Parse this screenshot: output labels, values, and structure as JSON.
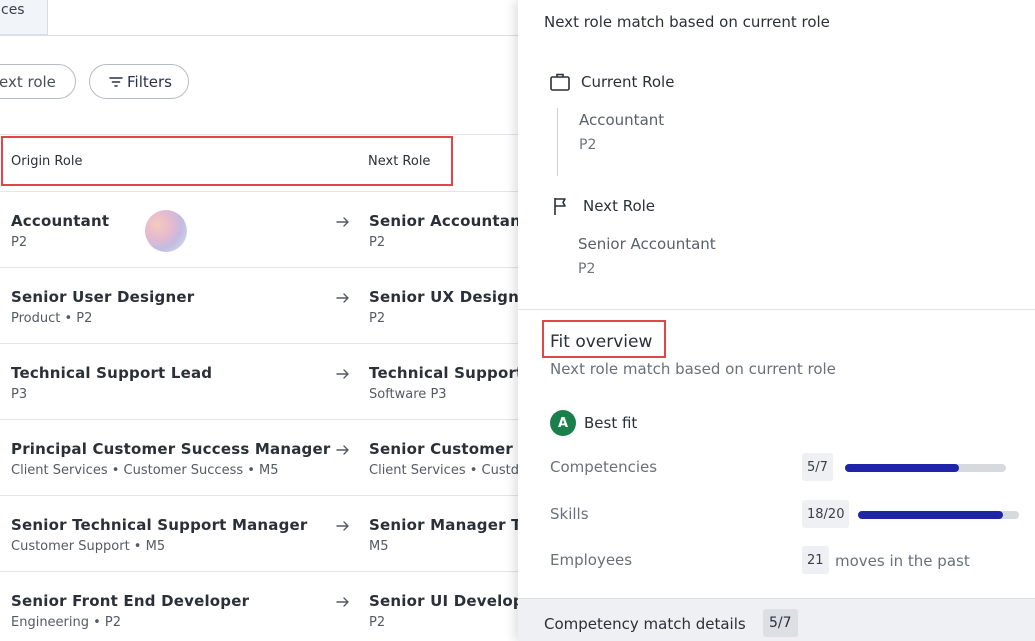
{
  "left": {
    "tab_fragment": "ces",
    "toolbar": {
      "next_role_pill": "ext role",
      "filters_label": "Filters"
    },
    "table": {
      "headers": {
        "origin": "Origin Role",
        "next": "Next Role"
      },
      "rows": [
        {
          "origin_title": "Accountant",
          "origin_sub": "P2",
          "next_title": "Senior Accountant",
          "next_sub": "P2"
        },
        {
          "origin_title": "Senior User Designer",
          "origin_sub": "Product • P2",
          "next_title": "Senior UX Designer",
          "next_sub": "P2"
        },
        {
          "origin_title": "Technical Support Lead",
          "origin_sub": "P3",
          "next_title": "Technical Support",
          "next_sub": "Software P3"
        },
        {
          "origin_title": "Principal Customer Success Manager",
          "origin_sub": "Client Services • Customer Success • M5",
          "next_title": "Senior Customer S",
          "next_sub": "Client Services • Custd"
        },
        {
          "origin_title": "Senior Technical Support Manager",
          "origin_sub": "Customer Support • M5",
          "next_title": "Senior Manager Te",
          "next_sub": "M5"
        },
        {
          "origin_title": "Senior Front End Developer",
          "origin_sub": "Engineering • P2",
          "next_title": "Senior UI Develope",
          "next_sub": "P2"
        }
      ]
    }
  },
  "right": {
    "title": "Next role match based on current role",
    "current_role": {
      "heading": "Current Role",
      "name": "Accountant",
      "grade": "P2"
    },
    "next_role": {
      "heading": "Next Role",
      "name": "Senior Accountant",
      "grade": "P2"
    },
    "fit": {
      "title": "Fit overview",
      "subtitle": "Next role match based on current role",
      "badge_letter": "A",
      "badge_label": "Best fit",
      "competencies": {
        "label": "Competencies",
        "value": "5/7",
        "progress": 0.71
      },
      "skills": {
        "label": "Skills",
        "value": "18/20",
        "progress": 0.9
      },
      "employees": {
        "label": "Employees",
        "value": "21",
        "suffix": "moves in the past"
      }
    },
    "footer": {
      "label": "Competency match details",
      "value": "5/7"
    }
  },
  "colors": {
    "highlight_red": "#e0474c",
    "progress_fill": "#1f24a8",
    "progress_track": "#d6d9de",
    "best_fit_green": "#1a7f4b"
  }
}
